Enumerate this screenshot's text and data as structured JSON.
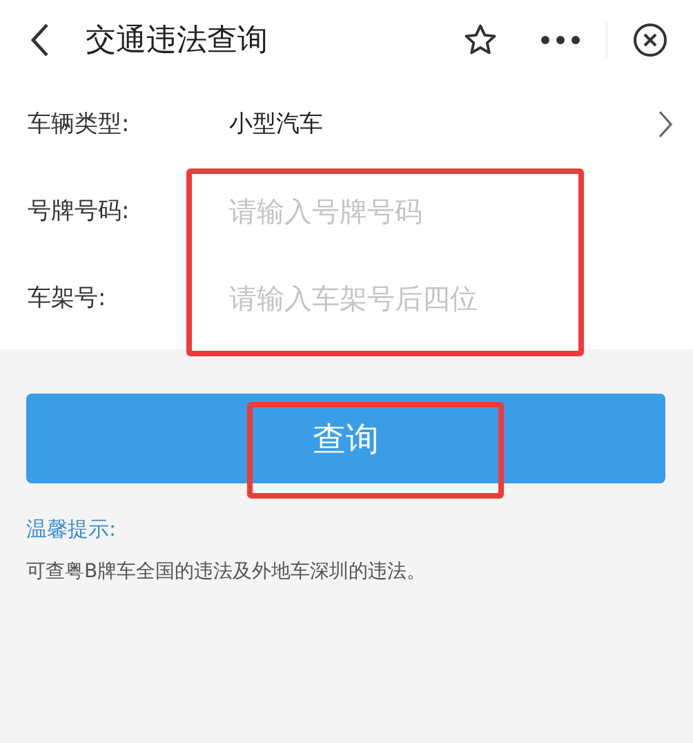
{
  "header": {
    "title": "交通违法查询"
  },
  "form": {
    "fields": [
      {
        "kind": "select",
        "label": "车辆类型:",
        "value": "小型汽车"
      },
      {
        "kind": "input",
        "label": "号牌号码:",
        "placeholder": "请输入号牌号码"
      },
      {
        "kind": "input",
        "label": "车架号:",
        "placeholder": "请输入车架号后四位"
      }
    ]
  },
  "button": {
    "label": "查询"
  },
  "tips": {
    "title": "温馨提示:",
    "text": "可查粤B牌车全国的违法及外地车深圳的违法。"
  }
}
